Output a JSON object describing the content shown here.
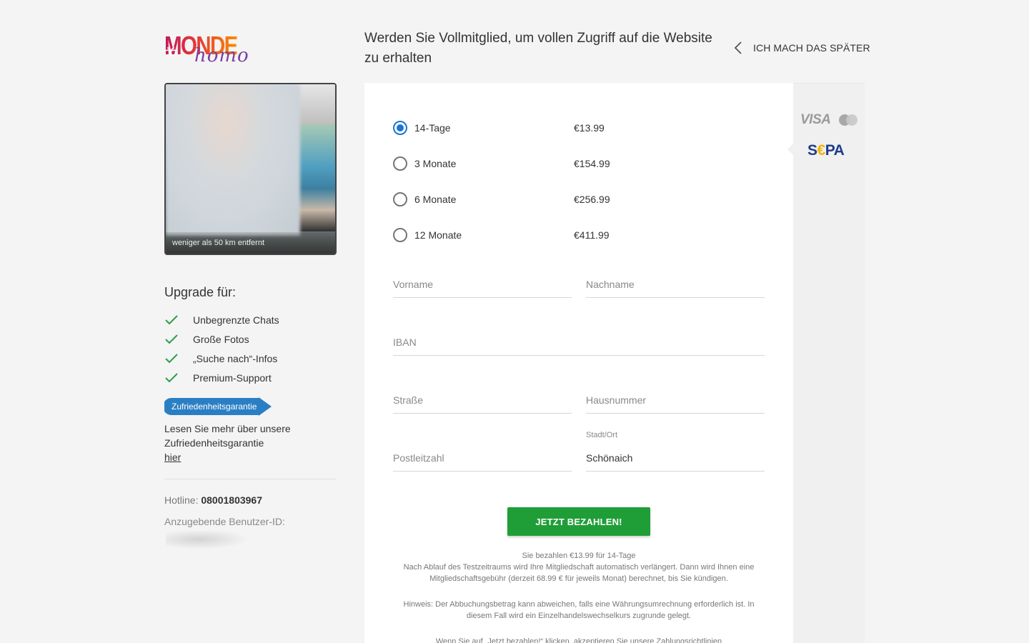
{
  "logo": {
    "brand": "MONDE",
    "sub": "homo"
  },
  "header": {
    "headline": "Werden Sie Vollmitglied, um vollen Zugriff auf die Website zu erhalten",
    "later_label": "ICH MACH DAS SPÄTER"
  },
  "profile": {
    "distance": "weniger als 50 km entfernt"
  },
  "upgrade": {
    "title": "Upgrade für:",
    "features": [
      "Unbegrenzte Chats",
      "Große Fotos",
      "„Suche nach“-Infos",
      "Premium-Support"
    ],
    "guarantee_badge": "Zufriedenheitsgarantie",
    "learn_text": "Lesen Sie mehr über unsere Zufriedenheitsgarantie",
    "learn_link": "hier"
  },
  "contact": {
    "hotline_label": "Hotline:",
    "hotline_number": "08001803967",
    "userid_label": "Anzugebende Benutzer-ID:"
  },
  "plans": [
    {
      "name": "14-Tage",
      "price": "€13.99",
      "selected": true
    },
    {
      "name": "3 Monate",
      "price": "€154.99",
      "selected": false
    },
    {
      "name": "6 Monate",
      "price": "€256.99",
      "selected": false
    },
    {
      "name": "12 Monate",
      "price": "€411.99",
      "selected": false
    }
  ],
  "form": {
    "first_name_placeholder": "Vorname",
    "last_name_placeholder": "Nachname",
    "iban_placeholder": "IBAN",
    "street_placeholder": "Straße",
    "house_number_placeholder": "Hausnummer",
    "zip_placeholder": "Postleitzahl",
    "city_label": "Stadt/Ort",
    "city_value": "Schönaich"
  },
  "payment_methods": {
    "visa": "VISA",
    "sepa_s": "S",
    "sepa_euro": "€",
    "sepa_pa": "PA"
  },
  "pay_button": "JETZT BEZAHLEN!",
  "fine_print": {
    "line1": "Sie bezahlen €13.99 für 14-Tage",
    "line2": "Nach Ablauf des Testzeitraums wird Ihre Mitgliedschaft automatisch verlängert. Dann wird Ihnen eine Mitgliedschaftsgebühr (derzeit 68.99 € für jeweils Monat) berechnet, bis Sie kündigen.",
    "note": "Hinweis: Der Abbuchungsbetrag kann abweichen, falls eine Währungsumrechnung erforderlich ist. In diesem Fall wird ein Einzelhandelswechselkurs zugrunde gelegt.",
    "terms": "Wenn Sie auf „Jetzt bezahlen!“ klicken, akzeptieren Sie unsere Zahlungsrichtlinien"
  },
  "colors": {
    "accent_blue": "#1976d2",
    "pay_green": "#1f9e37",
    "check_green": "#2e9e4a",
    "badge_blue": "#2a7fc4"
  }
}
